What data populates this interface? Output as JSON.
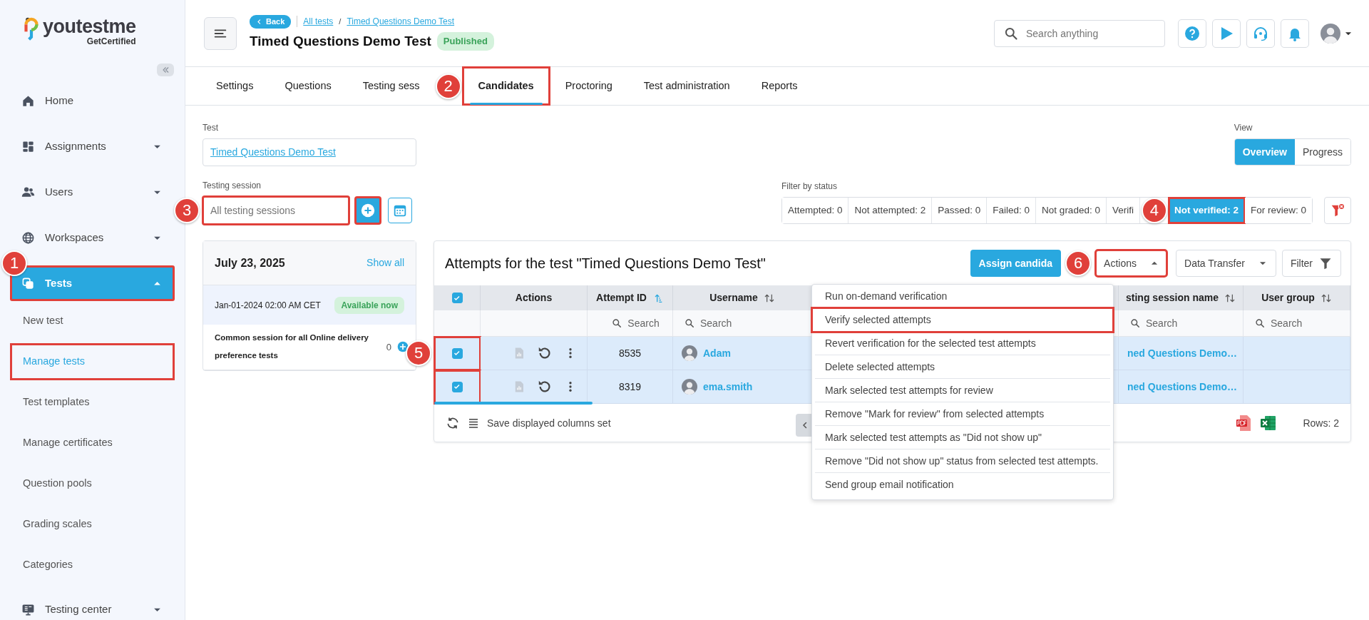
{
  "sidebar": {
    "brand": "youtestme",
    "tagline": "GetCertified",
    "items": [
      {
        "kind": "link",
        "label": "Home",
        "selected": false
      },
      {
        "kind": "group",
        "label": "Assignments",
        "selected": false,
        "expanded": false
      },
      {
        "kind": "group",
        "label": "Users",
        "selected": false,
        "expanded": false
      },
      {
        "kind": "group",
        "label": "Workspaces",
        "selected": false,
        "expanded": false
      },
      {
        "kind": "group",
        "label": "Tests",
        "selected": true,
        "expanded": true,
        "highlighted": true,
        "callout": "1",
        "children": [
          {
            "label": "New test",
            "selected": false
          },
          {
            "label": "Manage tests",
            "selected": true,
            "highlighted": true
          },
          {
            "label": "Test templates",
            "selected": false
          },
          {
            "label": "Manage certificates",
            "selected": false
          },
          {
            "label": "Question pools",
            "selected": false
          },
          {
            "label": "Grading scales",
            "selected": false
          },
          {
            "label": "Categories",
            "selected": false
          }
        ]
      },
      {
        "kind": "group",
        "label": "Testing center",
        "selected": false,
        "expanded": false
      }
    ]
  },
  "header": {
    "back": "Back",
    "breadcrumbs": [
      "All tests",
      "Timed Questions Demo Test"
    ],
    "breadcrumb_separator": "/",
    "title": "Timed Questions Demo Test",
    "status": "Published",
    "search": {
      "placeholder": "Search anything"
    }
  },
  "tabs": [
    {
      "label": "Settings",
      "selected": false
    },
    {
      "label": "Questions",
      "selected": false
    },
    {
      "label": "Testing sess",
      "selected": false
    },
    {
      "label": "Candidates",
      "selected": true,
      "highlighted": true,
      "callout": "2"
    },
    {
      "label": "Proctoring",
      "selected": false
    },
    {
      "label": "Test administration",
      "selected": false
    },
    {
      "label": "Reports",
      "selected": false
    }
  ],
  "test_field": {
    "label": "Test",
    "value": "Timed Questions Demo Test"
  },
  "session_field": {
    "label": "Testing session",
    "placeholder": "All testing sessions",
    "highlighted": true,
    "callout": "3",
    "add_highlighted": true
  },
  "session_card": {
    "date": "July 23, 2025",
    "show_all": "Show all",
    "slot": {
      "time": "Jan-01-2024 02:00 AM CET",
      "badge": "Available now"
    },
    "sessions": [
      {
        "name": "Common session for all Online delivery preference tests",
        "count": "0"
      }
    ]
  },
  "view": {
    "label": "View",
    "options": [
      {
        "label": "Overview",
        "selected": true
      },
      {
        "label": "Progress",
        "selected": false
      }
    ]
  },
  "status_filter": {
    "label": "Filter by status",
    "options": [
      {
        "label": "Attempted: 0",
        "selected": false
      },
      {
        "label": "Not attempted: 2",
        "selected": false
      },
      {
        "label": "Passed: 0",
        "selected": false
      },
      {
        "label": "Failed: 0",
        "selected": false
      },
      {
        "label": "Not graded: 0",
        "selected": false
      },
      {
        "label": "Verifi",
        "selected": false
      },
      {
        "label": "Not verified: 2",
        "selected": true,
        "highlighted": true,
        "callout": "4"
      },
      {
        "label": "For review: 0",
        "selected": false
      }
    ]
  },
  "attempts": {
    "title": "Attempts for the test \"Timed Questions Demo Test\"",
    "assign": "Assign candida",
    "actions": {
      "label": "Actions",
      "expanded": true,
      "highlighted": true,
      "callout": "6"
    },
    "data_transfer": "Data Transfer",
    "filter": "Filter",
    "select_all": {
      "checked": true
    },
    "checkbox_column_highlighted": true,
    "columns": [
      {
        "label": "Actions"
      },
      {
        "label": "Attempt ID",
        "sorted": true,
        "search": "Search"
      },
      {
        "label": "Username",
        "sorted": false,
        "search": "Search"
      },
      {
        "label": "sting session name",
        "sorted": false,
        "search": "Search"
      },
      {
        "label": "User group",
        "sorted": false,
        "search": "Search"
      }
    ],
    "rows": [
      {
        "checked": true,
        "attempt_id": "8535",
        "username": "Adam",
        "session": "ned Questions Demo…",
        "callout": "5"
      },
      {
        "checked": true,
        "attempt_id": "8319",
        "username": "ema.smith",
        "session": "ned Questions Demo…"
      }
    ],
    "save_columns": "Save displayed columns set",
    "row_count": "Rows: 2",
    "menu": [
      {
        "label": "Run on-demand verification",
        "highlighted": false
      },
      {
        "label": "Verify selected attempts",
        "highlighted": true
      },
      {
        "label": "Revert verification for the selected test attempts",
        "highlighted": false
      },
      {
        "label": "Delete selected attempts",
        "highlighted": false
      },
      {
        "label": "Mark selected test attempts for review",
        "highlighted": false
      },
      {
        "label": "Remove \"Mark for review\" from selected attempts",
        "highlighted": false
      },
      {
        "label": "Mark selected test attempts as \"Did not show up\"",
        "highlighted": false
      },
      {
        "label": "Remove \"Did not show up\" status from selected test attempts.",
        "highlighted": false
      },
      {
        "label": "Send group email notification",
        "highlighted": false
      }
    ]
  }
}
